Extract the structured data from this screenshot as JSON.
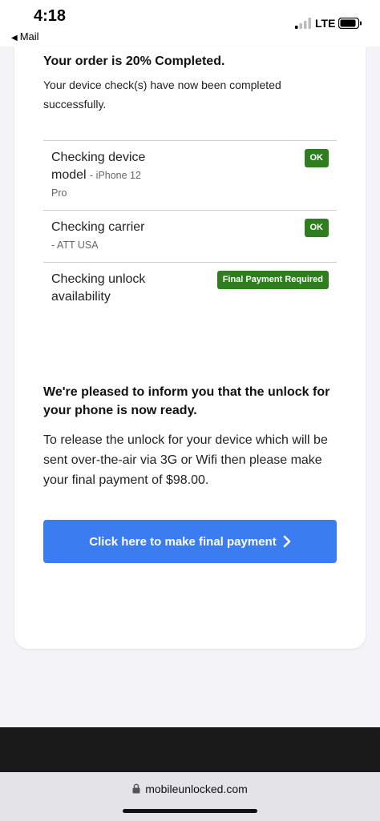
{
  "status_bar": {
    "time": "4:18",
    "back_app": "Mail",
    "network": "LTE"
  },
  "order": {
    "title": "Your order is 20% Completed.",
    "subtitle": "Your device check(s) have now been completed successfully."
  },
  "checks": [
    {
      "label": "Checking device model",
      "detail": "- iPhone 12 Pro",
      "status": "OK"
    },
    {
      "label": "Checking carrier",
      "detail": "- ATT USA",
      "status": "OK"
    },
    {
      "label": "Checking unlock availability",
      "detail": "",
      "status": "Final Payment Required"
    }
  ],
  "ready": {
    "title": "We're pleased to inform you that the unlock for your phone is now ready.",
    "body": "To release the unlock for your device which will be sent over-the-air via 3G or Wifi then please make your final payment of $98.00."
  },
  "payment_button": {
    "label": "Click here to make final payment"
  },
  "browser": {
    "url": "mobileunlocked.com"
  },
  "colors": {
    "ok_badge": "#2e7d1f",
    "button": "#3b7cf0"
  }
}
